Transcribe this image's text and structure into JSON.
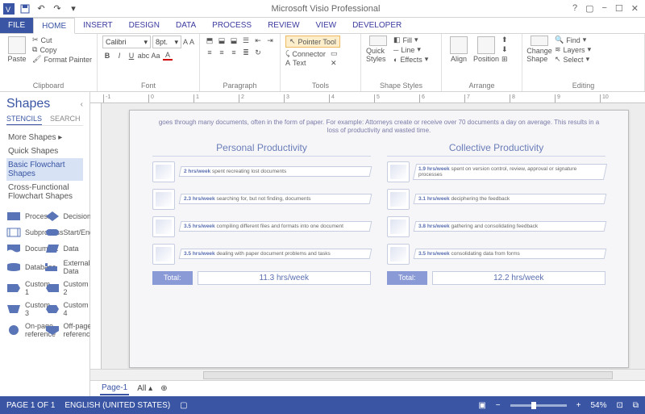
{
  "app_title": "Microsoft Visio Professional",
  "ribbon_tabs": [
    "FILE",
    "HOME",
    "INSERT",
    "DESIGN",
    "DATA",
    "PROCESS",
    "REVIEW",
    "VIEW",
    "DEVELOPER"
  ],
  "active_tab": "HOME",
  "clipboard": {
    "paste": "Paste",
    "cut": "Cut",
    "copy": "Copy",
    "fmt": "Format Painter",
    "label": "Clipboard"
  },
  "font": {
    "family": "Calibri",
    "size": "8pt.",
    "label": "Font"
  },
  "paragraph": {
    "label": "Paragraph"
  },
  "tools": {
    "pointer": "Pointer Tool",
    "connector": "Connector",
    "text": "Text",
    "label": "Tools"
  },
  "shape_styles": {
    "quick": "Quick Styles",
    "fill": "Fill",
    "line": "Line",
    "effects": "Effects",
    "label": "Shape Styles"
  },
  "arrange": {
    "align": "Align",
    "position": "Position",
    "label": "Arrange"
  },
  "editing": {
    "change": "Change Shape",
    "find": "Find",
    "layers": "Layers",
    "select": "Select",
    "label": "Editing"
  },
  "shapes_pane": {
    "title": "Shapes",
    "tabs": [
      "STENCILS",
      "SEARCH"
    ],
    "more": "More Shapes",
    "stencils": [
      "Quick Shapes",
      "Basic Flowchart Shapes",
      "Cross-Functional Flowchart Shapes"
    ],
    "selected_stencil": "Basic Flowchart Shapes",
    "shapes": [
      {
        "n": "Process",
        "t": "rect"
      },
      {
        "n": "Decision",
        "t": "diamond"
      },
      {
        "n": "Subprocess",
        "t": "rect2"
      },
      {
        "n": "Start/End",
        "t": "rounded"
      },
      {
        "n": "Document",
        "t": "doc"
      },
      {
        "n": "Data",
        "t": "para"
      },
      {
        "n": "Database",
        "t": "db"
      },
      {
        "n": "External Data",
        "t": "cyl"
      },
      {
        "n": "Custom 1",
        "t": "c1"
      },
      {
        "n": "Custom 2",
        "t": "c2"
      },
      {
        "n": "Custom 3",
        "t": "c3"
      },
      {
        "n": "Custom 4",
        "t": "c4"
      },
      {
        "n": "On-page reference",
        "t": "circle"
      },
      {
        "n": "Off-page reference",
        "t": "penta"
      }
    ]
  },
  "canvas": {
    "intro": "goes through many documents, often in the form of paper. For example: Attorneys create or receive over 70 documents a day on average. This results in a loss of productivity and wasted time.",
    "left": {
      "title": "Personal Productivity",
      "items": [
        {
          "b": "2 hrs/week",
          "t": " spent recreating lost documents"
        },
        {
          "b": "2.3 hrs/week",
          "t": " searching for, but not finding, documents"
        },
        {
          "b": "3.5 hrs/week",
          "t": " compiling different files and formats into one document"
        },
        {
          "b": "3.5 hrs/week",
          "t": " dealing with paper document problems and tasks"
        }
      ],
      "total_label": "Total:",
      "total": "11.3 hrs/week"
    },
    "right": {
      "title": "Collective Productivity",
      "items": [
        {
          "b": "1.9 hrs/week",
          "t": " spent on version control, review, approval or signature processes"
        },
        {
          "b": "3.1 hrs/week",
          "t": " deciphering the feedback"
        },
        {
          "b": "3.8 hrs/week",
          "t": " gathering and consolidating feedback"
        },
        {
          "b": "3.5 hrs/week",
          "t": " consolidating data from forms"
        }
      ],
      "total_label": "Total:",
      "total": "12.2 hrs/week"
    }
  },
  "page_tabs": {
    "page": "Page-1",
    "all": "All"
  },
  "status": {
    "page": "PAGE 1 OF 1",
    "lang": "ENGLISH (UNITED STATES)",
    "zoom": "54%"
  },
  "ruler_marks": [
    "-1",
    "0",
    "1",
    "2",
    "3",
    "4",
    "5",
    "6",
    "7",
    "8",
    "9",
    "10"
  ]
}
